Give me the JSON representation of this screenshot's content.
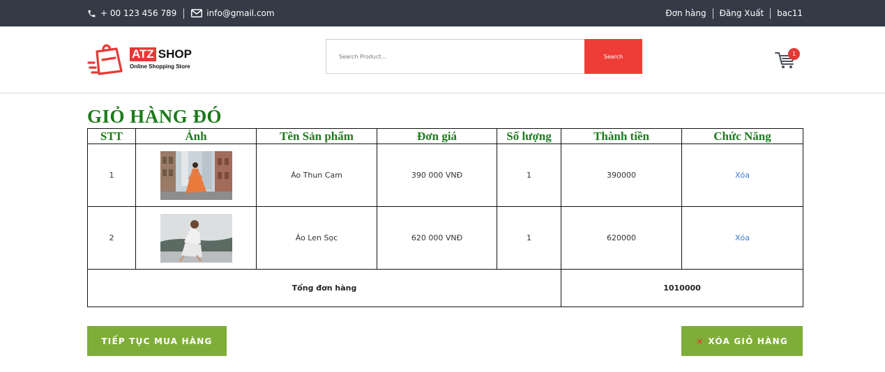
{
  "topbar": {
    "phone": "+ 00 123 456 789",
    "email": "info@gmail.com",
    "links": [
      "Đơn hàng",
      "Đăng Xuất",
      "bac11"
    ]
  },
  "logo": {
    "atz": "ATZ",
    "shop": "SHOP",
    "tagline": "Online Shopping Store"
  },
  "search": {
    "placeholder": "Search Product...",
    "button_label": "Search"
  },
  "cart": {
    "badge_count": "1"
  },
  "page_title": "GIỎ HÀNG ĐÓ",
  "table": {
    "headers": [
      "STT",
      "Ảnh",
      "Tên Sản phẩm",
      "Đơn giá",
      "Số lượng",
      "Thành tiền",
      "Chức Năng"
    ],
    "rows": [
      {
        "stt": "1",
        "name": "Áo Thun Cam",
        "unit_price": "390 000 VNĐ",
        "quantity": "1",
        "total": "390000",
        "action": "Xóa"
      },
      {
        "stt": "2",
        "name": "Áo Len Sọc",
        "unit_price": "620 000 VNĐ",
        "quantity": "1",
        "total": "620000",
        "action": "Xóa"
      }
    ],
    "total_label": "Tổng đơn hàng",
    "total_value": "1010000"
  },
  "buttons": {
    "continue_label": "TIẾP TỤC MUA HÀNG",
    "clear_icon": "×",
    "clear_label": "XÓA GIỎ HÀNG"
  },
  "colors": {
    "topbar_bg": "#343a46",
    "accent_red": "#ee3d36",
    "title_green": "#1d7a1d",
    "button_green": "#7fad39",
    "link_blue": "#3a78d6"
  }
}
